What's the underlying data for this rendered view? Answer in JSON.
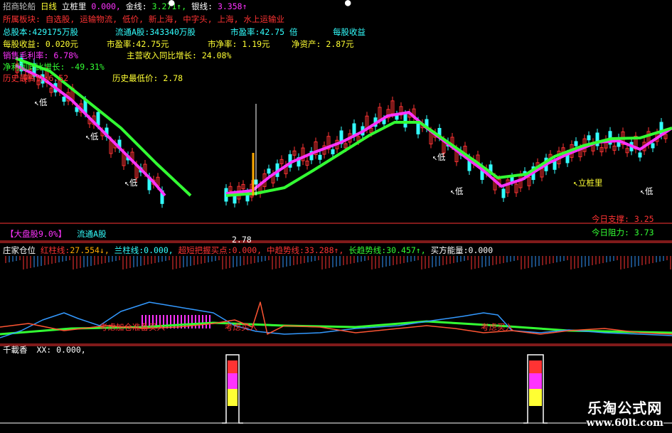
{
  "colors": {
    "red": "#ff3333",
    "green": "#33ff33",
    "yellow": "#ffff33",
    "magenta": "#ff33ff",
    "cyan": "#33ffff",
    "white": "#ffffff",
    "orange": "#ffaa00",
    "blue": "#3399ff",
    "grey": "#c0c0c0"
  },
  "header": {
    "stock": "招商轮船",
    "period": "日线",
    "indicator": "立桩里",
    "v0": "0.000,",
    "gold_label": "金线:",
    "gold_val": "3.271↑,",
    "silver_label": "银线:",
    "silver_val": "3.358↑"
  },
  "info": {
    "sector_label": "所属板块:",
    "sector_val": "自选股, 运输物流, 低价, 新上海, 中字头, 上海, 水上运输业",
    "total_shares": "总股本:429175万股",
    "float_a": "流通A股:343340万股",
    "pe_ttm": "市盈率:42.75 倍",
    "eps_label": "每股收益",
    "eps": "每股收益: 0.020元",
    "pe": "市盈率:42.75元",
    "pb": "市净率: 1.19元",
    "nav": "净资产: 2.87元",
    "gross_margin": "销售毛利率: 6.78%",
    "rev_growth": "主营收入同比增长: 24.08%",
    "profit_growth_label": "净利润同比增长:",
    "profit_growth": "-49.31%",
    "hist_high": "历史最高价:6.52",
    "hist_low": "历史最低价: 2.78"
  },
  "main_labels": {
    "low": "低",
    "pile": "立桩里",
    "support": "今日支撑: 3.25",
    "resist": "今日阻力: 3.73"
  },
  "mid_header": {
    "market": "【大盘股9.0%】",
    "float": "流通A股",
    "low_price": "2.78",
    "title": "庄家仓位",
    "red_label": "红柱线:",
    "red_val": "27.554↓,",
    "blue_label": "兰柱线:",
    "blue_val": "0.000,",
    "ultra_label": "超短把握买点:",
    "ultra_val": "0.000,",
    "mid_label": "中趋势线:",
    "mid_val": "33.288↑,",
    "long_label": "长趋势线:",
    "long_val": "30.457↑,",
    "buy_label": "买方能量:",
    "buy_val": "0.000"
  },
  "mid_annot": {
    "a1": "考虑加仓准备买入",
    "a2": "考虑买入",
    "a3": "考虑买入"
  },
  "low_header": {
    "title": "千載香",
    "xx": "XX: 0.000,"
  },
  "watermark": {
    "cn": "乐淘公式网",
    "url": "www.60lt.com"
  }
}
